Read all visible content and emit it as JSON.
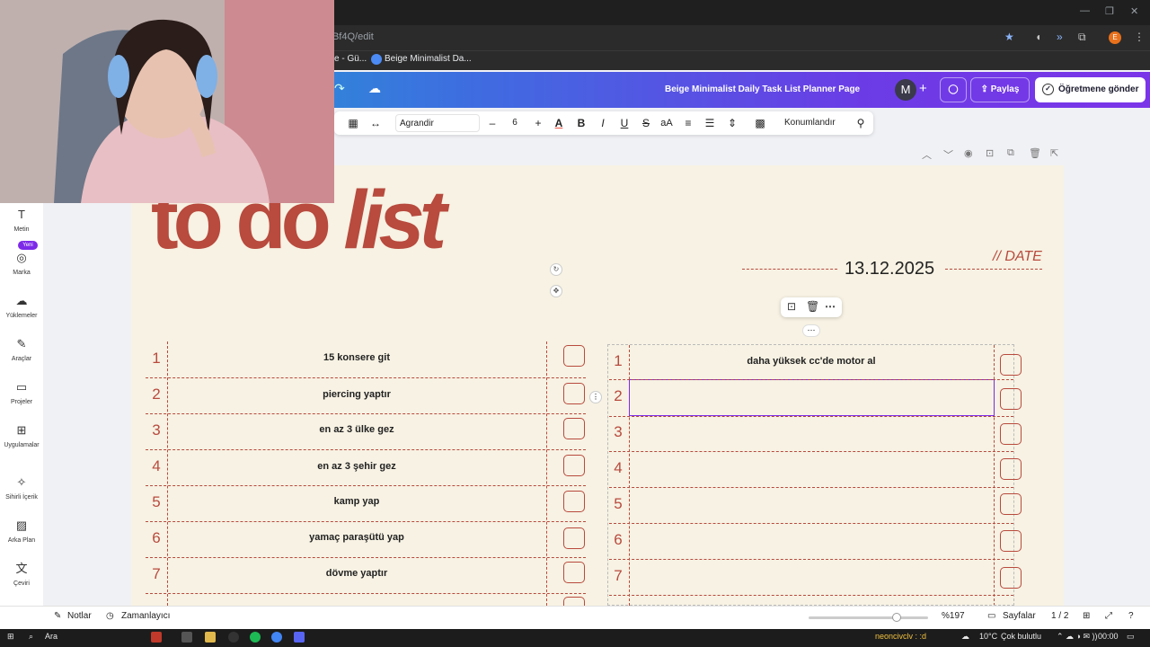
{
  "browser": {
    "url_partial": "3ze08Bf4Q/edit",
    "bookmarks": [
      {
        "label": "e - Gü..."
      },
      {
        "label": "Beige Minimalist Da..."
      }
    ],
    "profile_initial": "E"
  },
  "header": {
    "doc_title": "Beige Minimalist Daily Task List Planner Page",
    "avatar_initial": "M",
    "share_label": "Paylaş",
    "send_label": "Öğretmene gönder"
  },
  "toolbar": {
    "font_name": "Agrandir",
    "font_size": "6",
    "minus": "–",
    "plus": "+",
    "bold": "B",
    "italic": "I",
    "underline": "U",
    "strike": "S",
    "case": "aA",
    "position_label": "Konumlandır"
  },
  "sidebar": {
    "new_badge": "Yeni",
    "items": [
      {
        "label": "Metin",
        "icon": "text-icon"
      },
      {
        "label": "Marka",
        "icon": "brand-icon"
      },
      {
        "label": "Yüklemeler",
        "icon": "upload-icon"
      },
      {
        "label": "Araçlar",
        "icon": "pen-icon"
      },
      {
        "label": "Projeler",
        "icon": "folder-icon"
      },
      {
        "label": "Uygulamalar",
        "icon": "apps-icon"
      },
      {
        "label": "Sihirli İçerik",
        "icon": "magic-icon"
      },
      {
        "label": "Arka Plan",
        "icon": "background-icon"
      },
      {
        "label": "Çeviri",
        "icon": "translate-icon"
      }
    ]
  },
  "page": {
    "title_main": "to do ",
    "title_italic": "list",
    "date_value": "13.12.2025",
    "date_label": "// DATE",
    "left_list": [
      {
        "n": "1",
        "text": "15 konsere git"
      },
      {
        "n": "2",
        "text": "piercing yaptır"
      },
      {
        "n": "3",
        "text": "en az 3 ülke gez"
      },
      {
        "n": "4",
        "text": "en az 3 şehir gez"
      },
      {
        "n": "5",
        "text": "kamp yap"
      },
      {
        "n": "6",
        "text": "yamaç paraşütü yap"
      },
      {
        "n": "7",
        "text": "dövme yaptır"
      }
    ],
    "right_list": [
      {
        "n": "1",
        "text": "daha yüksek cc'de motor al"
      },
      {
        "n": "2",
        "text": ""
      },
      {
        "n": "3",
        "text": ""
      },
      {
        "n": "4",
        "text": ""
      },
      {
        "n": "5",
        "text": ""
      },
      {
        "n": "6",
        "text": ""
      },
      {
        "n": "7",
        "text": ""
      }
    ]
  },
  "bottom": {
    "notes": "Notlar",
    "timer": "Zamanlayıcı",
    "zoom": "%197",
    "pages": "Sayfalar",
    "page_count": "1 / 2"
  },
  "taskbar": {
    "search": "Ara",
    "weather": "10°C",
    "weather_desc": "Çok bulutlu",
    "time": "00:00",
    "overlay_text": "neoncivclv : :d"
  },
  "colors": {
    "accent_red": "#b84a3e",
    "paper": "#f7f2e3",
    "select_purple": "#7d2ae8"
  }
}
